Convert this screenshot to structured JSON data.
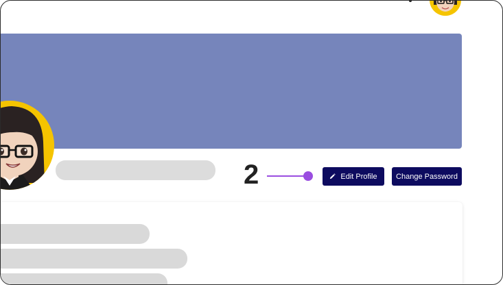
{
  "topbar": {
    "notification_icon": "bell-icon",
    "user_avatar": "cartoon-woman-avatar"
  },
  "profile": {
    "cover_color": "#7685bb",
    "avatar_ring_color": "#f5c400",
    "avatar": "cartoon-woman-avatar"
  },
  "callout": {
    "number": "2",
    "color": "#9a4de0"
  },
  "actions": {
    "edit_profile_label": "Edit Profile",
    "edit_icon": "pencil-icon",
    "change_password_label": "Change Password",
    "button_color": "#0d0b5f"
  }
}
